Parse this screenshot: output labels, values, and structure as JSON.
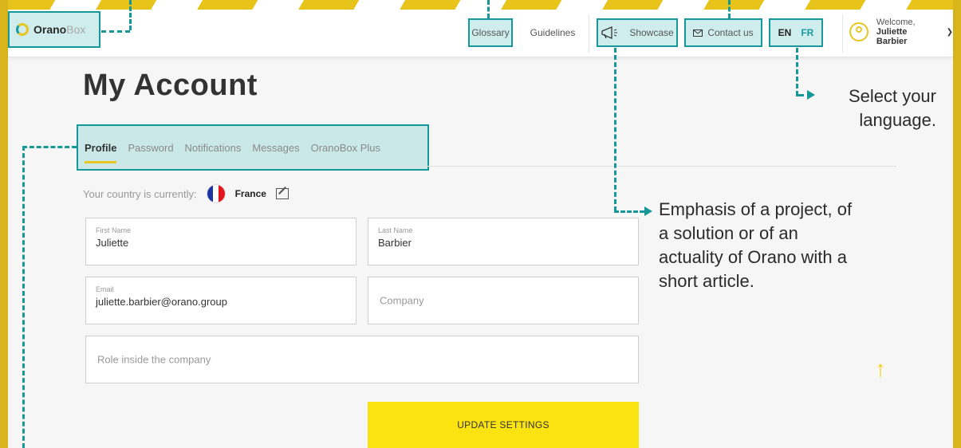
{
  "header": {
    "logo_part1": "Orano",
    "logo_part2": "Box",
    "nav": {
      "glossary": "Glossary",
      "guidelines": "Guidelines",
      "showcase": "Showcase",
      "contact": "Contact us"
    },
    "lang": {
      "en": "EN",
      "fr": "FR"
    },
    "user": {
      "welcome": "Welcome,",
      "name": "Juliette Barbier"
    }
  },
  "page": {
    "title": "My Account",
    "tabs": [
      "Profile",
      "Password",
      "Notifications",
      "Messages",
      "OranoBox Plus"
    ],
    "country_prefix": "Your country is currently:",
    "country": "France"
  },
  "form": {
    "first_name_label": "First Name",
    "first_name": "Juliette",
    "last_name_label": "Last Name",
    "last_name": "Barbier",
    "email_label": "Email",
    "email": "juliette.barbier@orano.group",
    "company_placeholder": "Company",
    "role_placeholder": "Role inside the company",
    "submit": "UPDATE SETTINGS"
  },
  "annotations": {
    "language": [
      "Select your",
      "language."
    ],
    "showcase": [
      "Emphasis of a project, of",
      "a solution or of an",
      "actuality of Orano with a",
      "short article."
    ]
  },
  "colors": {
    "accent_yellow": "#fbe312",
    "teal_annotation": "#16979a",
    "gold": "#d8b51b"
  }
}
